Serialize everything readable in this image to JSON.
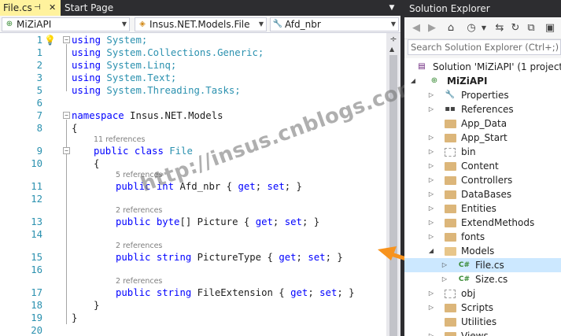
{
  "editor": {
    "tabs": [
      {
        "label": "File.cs",
        "active": true
      },
      {
        "label": "Start Page",
        "active": false
      }
    ],
    "nav": {
      "project": "MiZiAPI",
      "type": "Insus.NET.Models.File",
      "member": "Afd_nbr"
    },
    "lines": [
      {
        "num": "1",
        "text": "using System;"
      },
      {
        "num": "1",
        "text": "using System.Collections.Generic;"
      },
      {
        "num": "2",
        "text": "using System.Linq;"
      },
      {
        "num": "3",
        "text": "using System.Text;"
      },
      {
        "num": "5",
        "text": "using System.Threading.Tasks;"
      },
      {
        "num": "6",
        "text": ""
      },
      {
        "num": "7",
        "text": "namespace Insus.NET.Models"
      },
      {
        "num": "8",
        "text": "{"
      },
      {
        "num": "9",
        "text": "public class File"
      },
      {
        "num": "10",
        "text": "{"
      },
      {
        "num": "11",
        "text": "public int Afd_nbr { get; set; }"
      },
      {
        "num": "12",
        "text": ""
      },
      {
        "num": "13",
        "text": "public byte[] Picture { get; set; }"
      },
      {
        "num": "14",
        "text": ""
      },
      {
        "num": "15",
        "text": "public string PictureType { get; set; }"
      },
      {
        "num": "16",
        "text": ""
      },
      {
        "num": "17",
        "text": "public string FileExtension { get; set; }"
      },
      {
        "num": "18",
        "text": "}"
      },
      {
        "num": "19",
        "text": "}"
      },
      {
        "num": "20",
        "text": ""
      }
    ],
    "code": {
      "l1": {
        "kw": "using",
        "rest": " System;"
      },
      "l2": {
        "kw": "using",
        "rest": " System.Collections.Generic;"
      },
      "l3": {
        "kw": "using",
        "rest": " System.Linq;"
      },
      "l4": {
        "kw": "using",
        "rest": " System.Text;"
      },
      "l5": {
        "kw": "using",
        "rest": " System.Threading.Tasks;"
      },
      "l7": {
        "kw": "namespace",
        "rest": " Insus.NET.Models"
      },
      "brace_open": "{",
      "brace_close": "}",
      "l9": {
        "kw1": "public",
        "kw2": " class",
        "ty": " File"
      },
      "l11": {
        "kw1": "public",
        "kw2": " int",
        "rest": " Afd_nbr { ",
        "get": "get",
        "semi1": "; ",
        "set": "set",
        "end": "; }"
      },
      "l13": {
        "kw1": "public",
        "kw2": " byte",
        "rest": "[] Picture { ",
        "get": "get",
        "semi1": "; ",
        "set": "set",
        "end": "; }"
      },
      "l15": {
        "kw1": "public",
        "kw2": " string",
        "rest": " PictureType { ",
        "get": "get",
        "semi1": "; ",
        "set": "set",
        "end": "; }"
      },
      "l17": {
        "kw1": "public",
        "kw2": " string",
        "rest": " FileExtension { ",
        "get": "get",
        "semi1": "; ",
        "set": "set",
        "end": "; }"
      }
    },
    "lenses": {
      "class_refs": "11 references",
      "afd_refs": "5 references",
      "picture_refs": "2 references",
      "picturetype_refs": "2 references",
      "fileext_refs": "2 references"
    }
  },
  "watermark": "http://insus.cnblogs.com",
  "solution_explorer": {
    "title": "Solution Explorer",
    "search_placeholder": "Search Solution Explorer (Ctrl+;)",
    "nodes": [
      {
        "label": "Solution 'MiZiAPI' (1 project)",
        "icon": "solution-icon"
      },
      {
        "label": "MiZiAPI",
        "icon": "project-icon"
      },
      {
        "label": "Properties",
        "icon": "wrench-icon"
      },
      {
        "label": "References",
        "icon": "references-icon"
      },
      {
        "label": "App_Data",
        "icon": "folder-icon"
      },
      {
        "label": "App_Start",
        "icon": "folder-icon"
      },
      {
        "label": "bin",
        "icon": "folder-outline-icon"
      },
      {
        "label": "Content",
        "icon": "folder-icon"
      },
      {
        "label": "Controllers",
        "icon": "folder-icon"
      },
      {
        "label": "DataBases",
        "icon": "folder-icon"
      },
      {
        "label": "Entities",
        "icon": "folder-icon"
      },
      {
        "label": "ExtendMethods",
        "icon": "folder-icon"
      },
      {
        "label": "fonts",
        "icon": "folder-icon"
      },
      {
        "label": "Models",
        "icon": "folder-open-icon"
      },
      {
        "label": "File.cs",
        "icon": "csharp-file-icon",
        "selected": true
      },
      {
        "label": "Size.cs",
        "icon": "csharp-file-icon"
      },
      {
        "label": "obj",
        "icon": "folder-outline-icon"
      },
      {
        "label": "Scripts",
        "icon": "folder-icon"
      },
      {
        "label": "Utilities",
        "icon": "folder-icon"
      },
      {
        "label": "Views",
        "icon": "folder-icon"
      }
    ]
  },
  "colors": {
    "keyword": "#0000ff",
    "type": "#2b91af",
    "line_number": "#2b91af",
    "active_tab": "#fff29d",
    "selection": "#cce8ff",
    "arrow": "#f7931e"
  }
}
